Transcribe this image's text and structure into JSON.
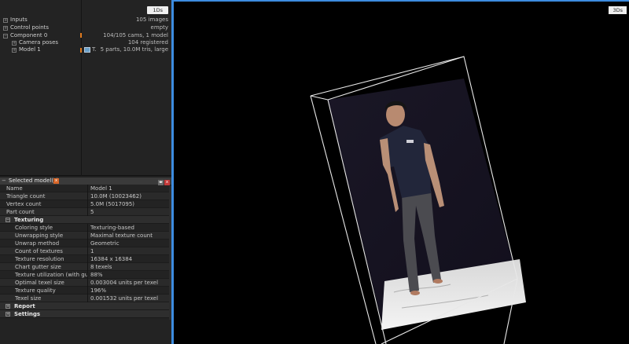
{
  "tree": {
    "tab_label": "1Ds",
    "items": [
      {
        "label": "Inputs",
        "value": "105 images",
        "toggle": "+"
      },
      {
        "label": "Control points",
        "value": "empty",
        "toggle": "+"
      },
      {
        "label": "Component 0",
        "value": "104/105 cams, 1 model",
        "toggle": "−"
      },
      {
        "label": "Camera poses",
        "value": "104 registered",
        "toggle": "+"
      },
      {
        "label": "Model 1",
        "value": "5 parts, 10.0M tris, large",
        "toggle": "+",
        "prefix": "T."
      }
    ]
  },
  "selected_panel": {
    "title": "Selected model(s)",
    "minimize_glyph": "−",
    "close_glyph": "x",
    "properties": [
      {
        "key": "Name",
        "value": "Model 1"
      },
      {
        "key": "Triangle count",
        "value": "10.0M (10023462)"
      },
      {
        "key": "Vertex count",
        "value": "5.0M (5017095)"
      },
      {
        "key": "Part count",
        "value": "5"
      }
    ],
    "texturing": {
      "label": "Texturing",
      "toggle": "−",
      "properties": [
        {
          "key": "Coloring style",
          "value": "Texturing-based"
        },
        {
          "key": "Unwrapping style",
          "value": "Maximal texture count"
        },
        {
          "key": "Unwrap method",
          "value": "Geometric"
        },
        {
          "key": "Count of textures",
          "value": "1"
        },
        {
          "key": "Texture resolution",
          "value": "16384 x 16384"
        },
        {
          "key": "Chart gutter size",
          "value": "8 texels"
        },
        {
          "key": "Texture utilization (with gutt...",
          "value": "88%"
        },
        {
          "key": "Optimal texel size",
          "value": "0.003004 units per texel"
        },
        {
          "key": "Texture quality",
          "value": "196%"
        },
        {
          "key": "Texel size",
          "value": "0.001532 units per texel"
        }
      ]
    },
    "sections": [
      {
        "label": "Report",
        "toggle": "+"
      },
      {
        "label": "Settings",
        "toggle": "+"
      }
    ]
  },
  "viewport": {
    "tab_label": "3Ds"
  },
  "colors": {
    "accent": "#3d8ce0",
    "orange": "#e07a1e"
  }
}
